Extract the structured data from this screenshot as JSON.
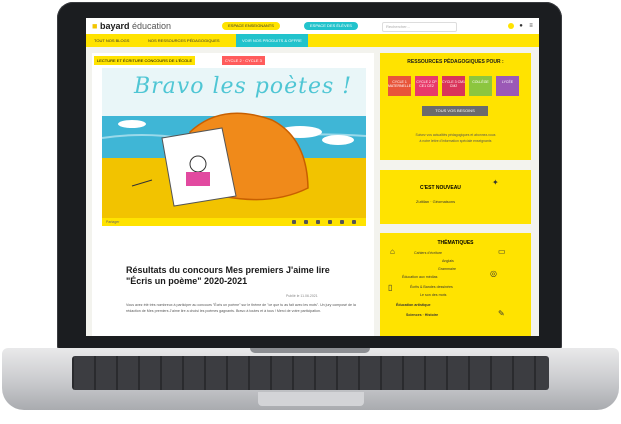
{
  "site": {
    "logo_bold": "bayard",
    "logo_light": "éducation",
    "top_pill_yellow": "ESPACE ENSEIGNANTS",
    "top_pill_cyan": "ESPACE DES ÉLÈVES",
    "search_placeholder": "Rechercher..."
  },
  "nav": {
    "items": [
      {
        "label": "TOUT NOS BLOGS"
      },
      {
        "label": "NOS RESSOURCES PÉDAGOGIQUES"
      },
      {
        "label": "VOIR NOS PRODUITS & OFFRE"
      }
    ]
  },
  "article": {
    "tag_category": "LECTURE ET ÉCRITURE  CONCOURS DE L'ÉCOLE",
    "tag_level": "CYCLE 2 · CYCLE 3",
    "hero_text": "Bravo les poètes !",
    "footer_text": "Partager",
    "title": "Résultats du concours Mes premiers J'aime lire \"Écris un poème\" 2020-2021",
    "date": "Publié le 11.06.2021",
    "body": "Vous avez été très nombreux à participer au concours \"Écris un poème\" sur le thème de \"ce que tu as fait avec les mots\". Un jury composé de la rédaction de Mes premiers J'aime lire a choisi les poèmes gagnants. Bravo à toutes et à tous ! Merci de votre participation."
  },
  "sidebar": {
    "card1_title": "RESSOURCES PÉDAGOGIQUES POUR :",
    "domains": [
      {
        "label": "CYCLE 1 MATERNELLE",
        "color": "#e8553a"
      },
      {
        "label": "CYCLE 2 CP CE1 CE2",
        "color": "#e83a6a"
      },
      {
        "label": "CYCLE 3 CM1 CM2",
        "color": "#d9345a"
      },
      {
        "label": "COLLÈGE",
        "color": "#8cc63f"
      },
      {
        "label": "LYCÉE",
        "color": "#9b59b6"
      }
    ],
    "card1_button": "TOUS VOS BESOINS",
    "card1_links": [
      "Suivez vos actualités pédagogiques et abonnez-vous",
      "à notre lettre d'information spéciale enseignants"
    ],
    "card2_title": "C'EST NOUVEAU",
    "card2_sub": "Zuttilan · Géomaisons",
    "card3_title": "THÉMATIQUES",
    "themes": [
      "Cahiers d'écriture",
      "Anglais",
      "Grammaire",
      "Éducation aux médias",
      "Écrits & Bandes dessinées",
      "Le son des mots",
      "Éducation artistique",
      "Sciences · Histoire"
    ]
  },
  "colors": {
    "brand_yellow": "#ffe300",
    "accent_cyan": "#22c3cc",
    "red_tag": "#ff5c5c"
  }
}
